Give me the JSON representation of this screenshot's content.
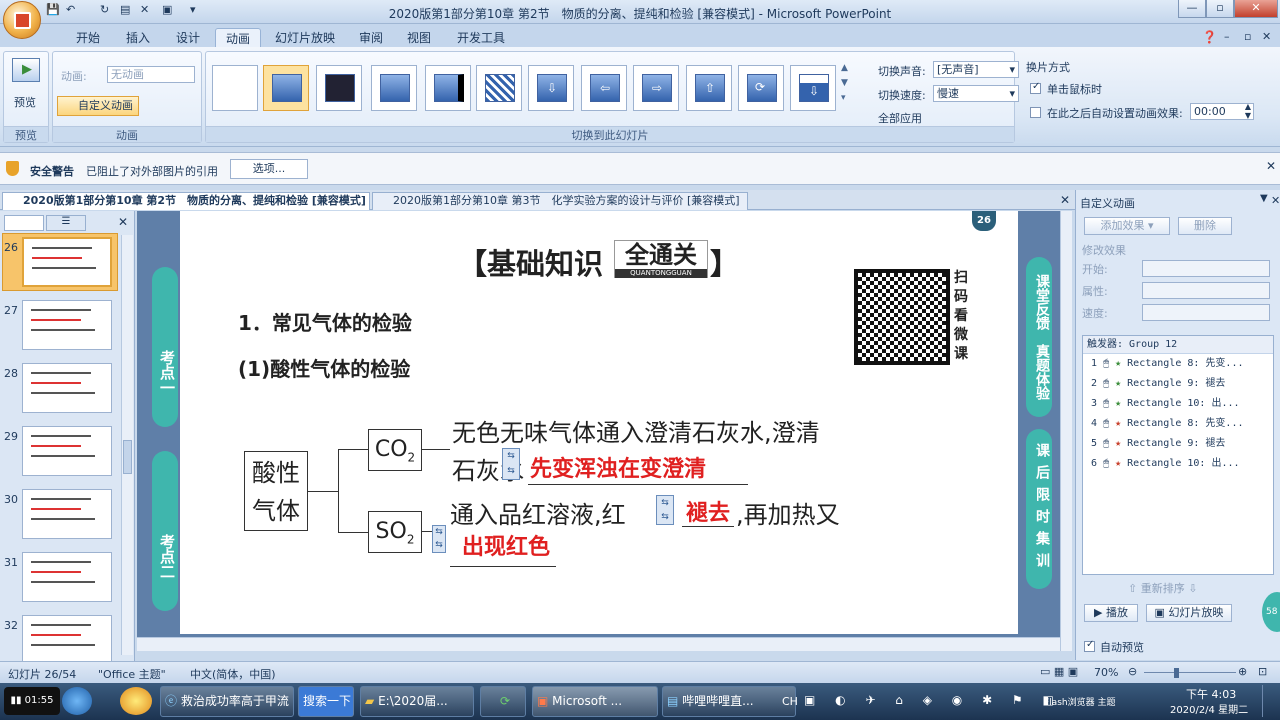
{
  "window": {
    "title": "2020版第1部分第10章 第2节　物质的分离、提纯和检验 [兼容模式] - Microsoft PowerPoint",
    "min": "—",
    "max": "▫",
    "close": "✕"
  },
  "tabs": [
    "开始",
    "插入",
    "设计",
    "动画",
    "幻灯片放映",
    "审阅",
    "视图",
    "开发工具"
  ],
  "active_tab": "动画",
  "ribbon": {
    "preview_group": {
      "button": "预览",
      "label": "预览"
    },
    "animation_group": {
      "anim_label": "动画:",
      "anim_value": "无动画",
      "custom_btn": "自定义动画",
      "label": "动画"
    },
    "transition_group": {
      "label": "切换到此幻灯片"
    },
    "sound_label": "切换声音:",
    "sound_value": "[无声音]",
    "speed_label": "切换速度:",
    "speed_value": "慢速",
    "apply_all": "全部应用",
    "advance": {
      "title": "换片方式",
      "on_click": "单击鼠标时",
      "auto": "在此之后自动设置动画效果:",
      "time": "00:00"
    }
  },
  "security": {
    "title": "安全警告",
    "message": "已阻止了对外部图片的引用",
    "options": "选项..."
  },
  "doc_tabs": [
    "2020版第1部分第10章 第2节　物质的分离、提纯和检验 [兼容模式]",
    "2020版第1部分第10章 第3节　化学实验方案的设计与评价 [兼容模式]"
  ],
  "slides": [
    {
      "num": "26"
    },
    {
      "num": "27"
    },
    {
      "num": "28"
    },
    {
      "num": "29"
    },
    {
      "num": "30"
    },
    {
      "num": "31"
    },
    {
      "num": "32"
    }
  ],
  "slide": {
    "page_badge": "26",
    "banner_left": "【基础知识",
    "banner_mid": "全通关",
    "banner_sub": "QUANTONGGUAN",
    "banner_right": "】",
    "qr_text": [
      "扫",
      "码",
      "看",
      "微",
      "课"
    ],
    "heading1": "1．常见气体的检验",
    "heading2": "(1)酸性气体的检验",
    "box_acid": [
      "酸性",
      "气体"
    ],
    "co2": "CO",
    "co2_sub": "2",
    "so2": "SO",
    "so2_sub": "2",
    "line1": "无色无味气体通入澄清石灰水,澄清",
    "line2_prefix": "石灰水",
    "answer1": "先变浑浊在变澄清",
    "line3": "通入品红溶液,红",
    "answer2": "褪去",
    "line3_suffix": ",再加热又",
    "answer3": "出现红色",
    "left_pills": [
      "考点一",
      "考点二"
    ],
    "right_pills": [
      "课堂反馈　真题体验",
      "课后限时集训"
    ]
  },
  "custom_anim": {
    "title": "自定义动画",
    "add_effect": "添加效果",
    "delete": "删除",
    "modify": "修改效果",
    "start": "开始:",
    "property": "属性:",
    "speed": "速度:",
    "trigger": "触发器: Group 12",
    "effects": [
      {
        "n": "1",
        "text": "Rectangle 8: 先变...",
        "color": "#3a8d3a"
      },
      {
        "n": "2",
        "text": "Rectangle 9: 褪去",
        "color": "#3a8d3a"
      },
      {
        "n": "3",
        "text": "Rectangle 10: 出...",
        "color": "#3a8d3a"
      },
      {
        "n": "4",
        "text": "Rectangle 8: 先变...",
        "color": "#c8402c"
      },
      {
        "n": "5",
        "text": "Rectangle 9: 褪去",
        "color": "#c8402c"
      },
      {
        "n": "6",
        "text": "Rectangle 10: 出...",
        "color": "#c8402c"
      }
    ],
    "reorder": "重新排序",
    "play": "播放",
    "slideshow": "幻灯片放映",
    "autopreview": "自动预览"
  },
  "status": {
    "slide_of": "幻灯片 26/54",
    "theme": "\"Office 主题\"",
    "lang": "中文(简体，中国)",
    "zoom": "70%"
  },
  "taskbar": {
    "time_left": "01:55",
    "items": [
      "救治成功率高于甲流",
      "搜索一下",
      "E:\\2020届...",
      "",
      "Microsoft ...",
      "哔哩哔哩直..."
    ],
    "lang": "CH",
    "flash": "Flash浏览器 主题",
    "clock": "下午 4:03",
    "date": "2020/2/4 星期二"
  },
  "colors": {
    "accent_teal": "#3fb6ad",
    "answer_red": "#e02020",
    "ribbon_blue": "#1e395b"
  }
}
